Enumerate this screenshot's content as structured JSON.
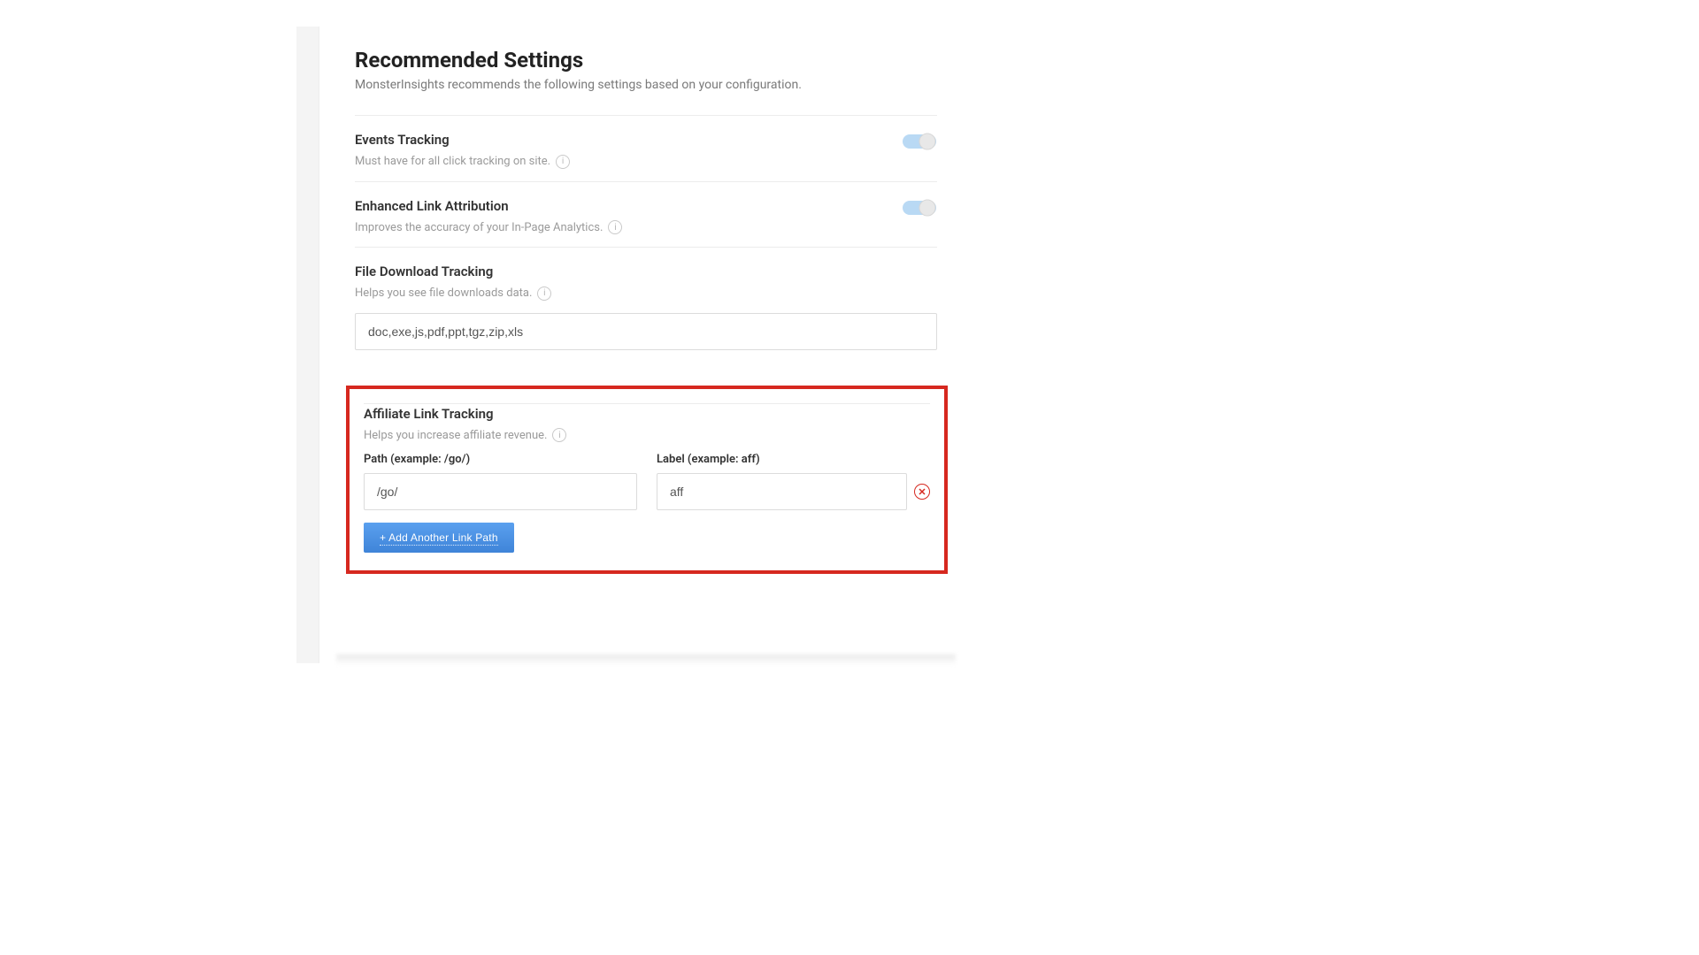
{
  "header": {
    "title": "Recommended Settings",
    "subtitle": "MonsterInsights recommends the following settings based on your configuration."
  },
  "rows": {
    "events": {
      "title": "Events Tracking",
      "desc": "Must have for all click tracking on site.",
      "toggle_on": true
    },
    "ela": {
      "title": "Enhanced Link Attribution",
      "desc": "Improves the accuracy of your In-Page Analytics.",
      "toggle_on": true
    },
    "filedl": {
      "title": "File Download Tracking",
      "desc": "Helps you see file downloads data.",
      "input_value": "doc,exe,js,pdf,ppt,tgz,zip,xls"
    },
    "affiliate": {
      "title": "Affiliate Link Tracking",
      "desc": "Helps you increase affiliate revenue.",
      "path_label": "Path (example: /go/)",
      "label_label": "Label (example: aff)",
      "path_value": "/go/",
      "label_value": "aff",
      "add_button": "+ Add Another Link Path"
    }
  },
  "colors": {
    "highlight": "#d6281f",
    "toggle_on": "#b9d9f4",
    "toggle_knob": "#e8e8e8",
    "button": "#4a90e2"
  }
}
